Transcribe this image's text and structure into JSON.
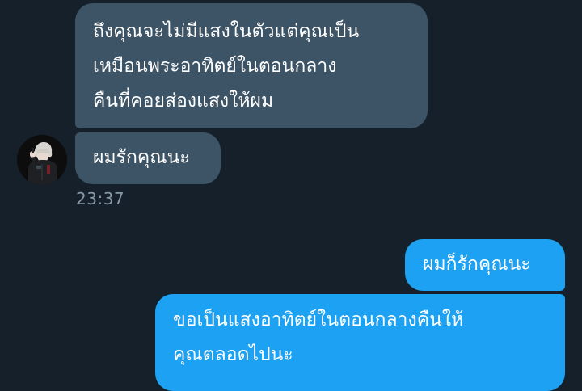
{
  "conversation": {
    "messages": [
      {
        "sender": "other",
        "text": "ถึงคุณจะไม่มีแสงในตัวแต่คุณเป็น\nเหมือนพระอาทิตย์ในตอนกลาง\nคืนที่คอยส่องแสงให้ผม"
      },
      {
        "sender": "other",
        "text": "ผมรักคุณนะ"
      },
      {
        "sender": "me",
        "text": "ผมก็รักคุณนะ"
      },
      {
        "sender": "me",
        "text": "ขอเป็นแสงอาทิตย์ในตอนกลางคืนให้\nคุณตลอดไปนะ"
      }
    ],
    "received_timestamp": "23:37"
  },
  "colors": {
    "background": "#15202b",
    "incoming_bubble": "#3d5466",
    "outgoing_bubble": "#1da1f2",
    "timestamp_text": "#8899a6"
  }
}
